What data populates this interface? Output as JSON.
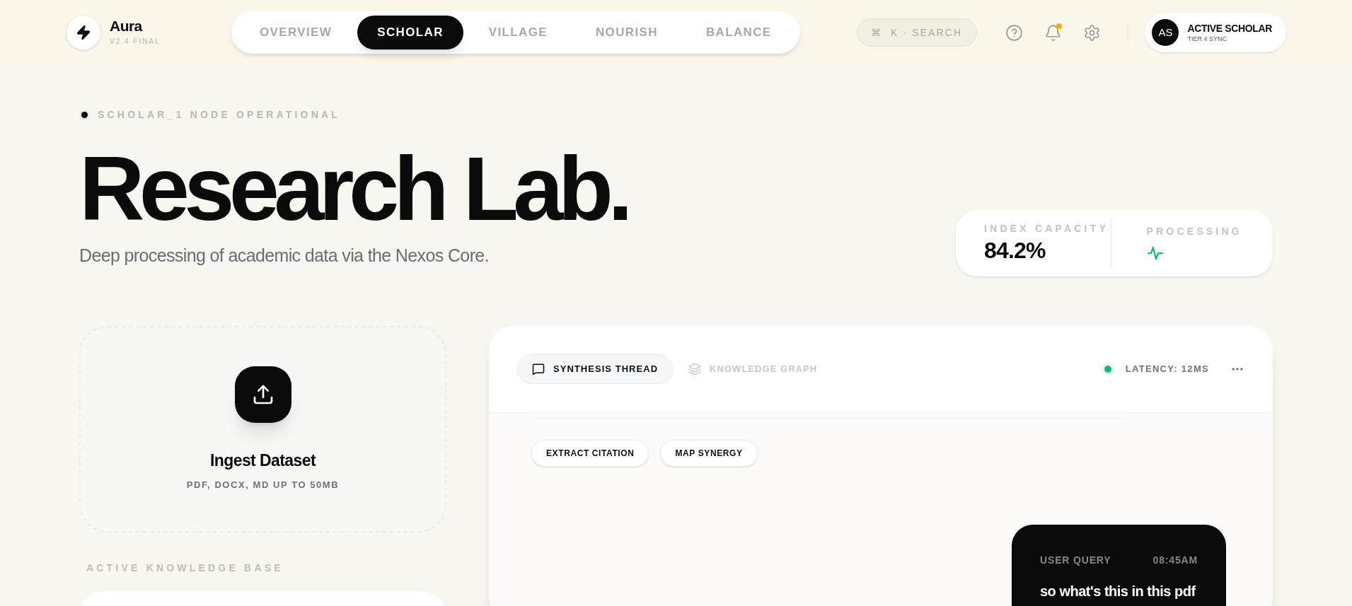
{
  "brand": {
    "name": "Aura",
    "version": "V2.4 FINAL"
  },
  "nav": [
    {
      "label": "OVERVIEW",
      "selected": false
    },
    {
      "label": "SCHOLAR",
      "selected": true
    },
    {
      "label": "VILLAGE",
      "selected": false
    },
    {
      "label": "NOURISH",
      "selected": false
    },
    {
      "label": "BALANCE",
      "selected": false
    }
  ],
  "search": {
    "shortcut": "⌘",
    "placeholder": "K · SEARCH"
  },
  "notifications": {
    "unread": true
  },
  "profile": {
    "initials": "AS",
    "name": "ACTIVE SCHOLAR",
    "tier": "TIER 4 SYNC"
  },
  "status": "SCHOLAR_1 NODE OPERATIONAL",
  "title": "Research Lab.",
  "subtitle": "Deep processing of academic data via the Nexos Core.",
  "stats": [
    {
      "kind": "value",
      "label": "INDEX CAPACITY",
      "value": "84.2%"
    },
    {
      "kind": "pulse",
      "label": "PROCESSING"
    }
  ],
  "upload": {
    "title": "Ingest Dataset",
    "hint": "PDF, DOCX, MD UP TO 50MB"
  },
  "knowledge_base": {
    "heading": "ACTIVE KNOWLEDGE BASE"
  },
  "thread": {
    "tabs": [
      {
        "label": "SYNTHESIS THREAD",
        "selected": true,
        "kind": "chat"
      },
      {
        "label": "KNOWLEDGE GRAPH",
        "selected": false,
        "kind": "layers"
      }
    ],
    "latency": "LATENCY: 12MS",
    "actions": [
      "EXTRACT CITATION",
      "MAP SYNERGY"
    ],
    "messages": [
      {
        "role": "USER QUERY",
        "time": "08:45AM",
        "text": "so what's this in this pdf"
      }
    ]
  }
}
